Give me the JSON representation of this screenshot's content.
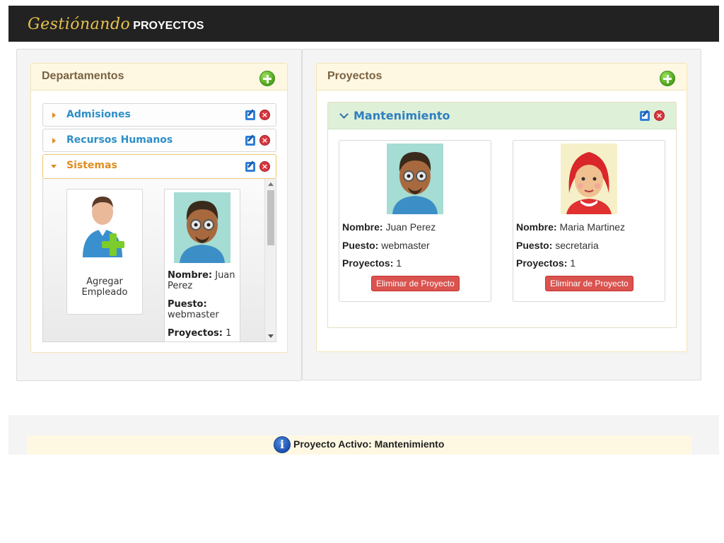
{
  "header": {
    "brand_script": "Gestiónando",
    "brand_text": "PROYECTOS"
  },
  "departments": {
    "title": "Departamentos",
    "items": [
      {
        "label": "Admisiones",
        "expanded": false
      },
      {
        "label": "Recursos Humanos",
        "expanded": false
      },
      {
        "label": "Sistemas",
        "expanded": true
      }
    ],
    "add_employee_label": "Agregar Empleado",
    "employee": {
      "nombre_label": "Nombre:",
      "nombre": "Juan Perez",
      "puesto_label": "Puesto:",
      "puesto": "webmaster",
      "proyectos_label": "Proyectos:",
      "proyectos": "1"
    }
  },
  "projects": {
    "title": "Proyectos",
    "active_project": "Mantenimiento",
    "members": [
      {
        "nombre_label": "Nombre:",
        "nombre": "Juan Perez",
        "puesto_label": "Puesto:",
        "puesto": "webmaster",
        "proyectos_label": "Proyectos:",
        "proyectos": "1",
        "button": "Eliminar de Proyecto",
        "avatar": "man-with-glasses"
      },
      {
        "nombre_label": "Nombre:",
        "nombre": "Maria Martinez",
        "puesto_label": "Puesto:",
        "puesto": "secretaria",
        "proyectos_label": "Proyectos:",
        "proyectos": "1",
        "button": "Eliminar de Proyecto",
        "avatar": "red-haired-woman"
      }
    ]
  },
  "footer": {
    "status": "Proyecto Activo: Mantenimiento",
    "icon": "info-icon"
  },
  "colors": {
    "header_bg": "#222222",
    "panel_header_bg": "#fef8e3",
    "accent_blue": "#2e8fc7",
    "accent_orange": "#e08b1e",
    "project_header_bg": "#dff0d8",
    "danger": "#d9534f"
  }
}
